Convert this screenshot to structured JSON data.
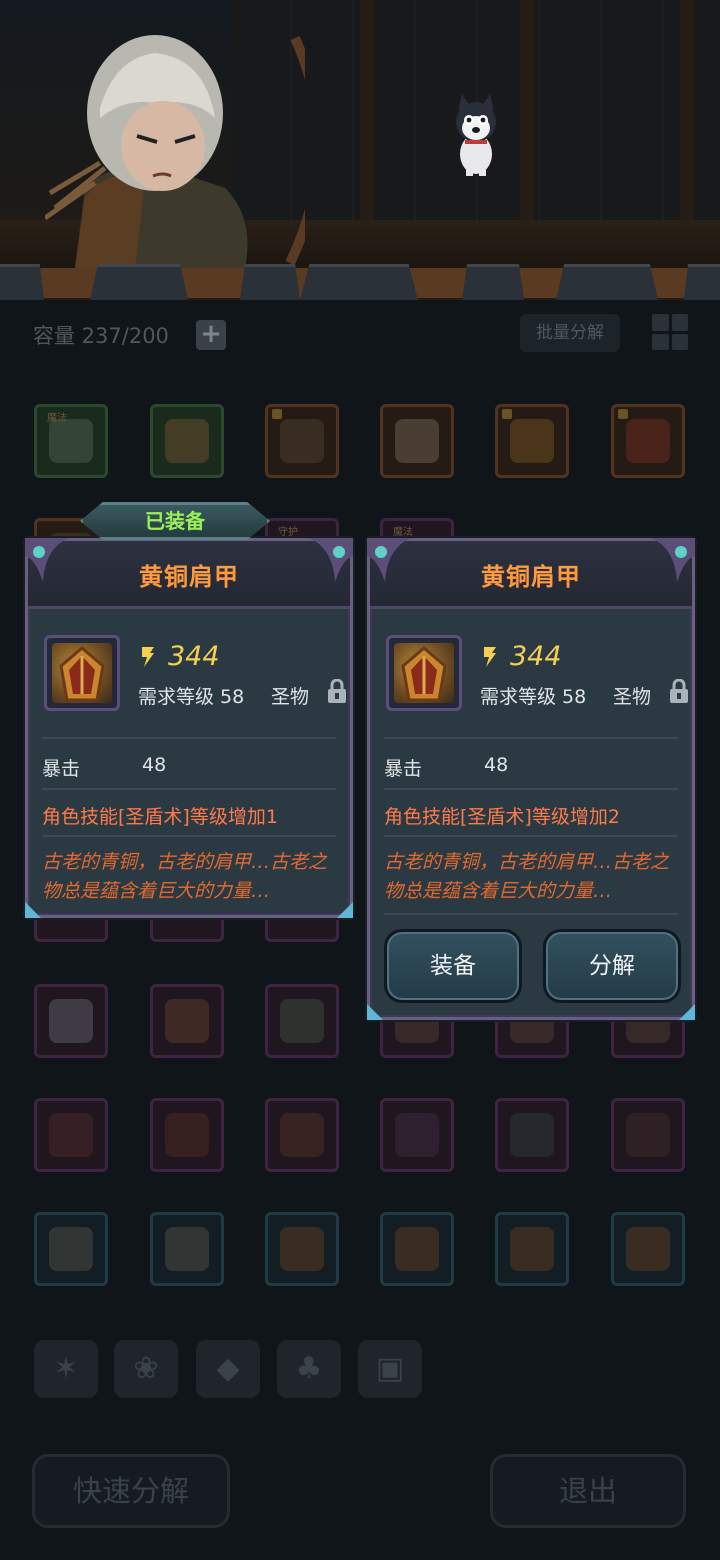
{
  "inventory": {
    "capacity_label": "容量 237/200",
    "batch_button": "批量分解",
    "slot_tags": [
      "魔法",
      "守护",
      "魔法"
    ]
  },
  "category_tabs": [
    "weapon-tab-icon",
    "pet-tab-icon",
    "gem-tab-icon",
    "material-tab-icon",
    "chest-tab-icon"
  ],
  "bottom": {
    "quick_decompose": "快速分解",
    "exit": "退出"
  },
  "equipped_label": "已装备",
  "equipped_card": {
    "title": "黄铜肩甲",
    "power": "344",
    "req_level": "需求等级 58",
    "rarity": "圣物",
    "stat_name": "暴击",
    "stat_value": "48",
    "skill": "角色技能[圣盾术]等级增加1",
    "lore": "古老的青铜，古老的肩甲…古老之物总是蕴含着巨大的力量…"
  },
  "compare_card": {
    "title": "黄铜肩甲",
    "power": "344",
    "req_level": "需求等级 58",
    "rarity": "圣物",
    "stat_name": "暴击",
    "stat_value": "48",
    "skill": "角色技能[圣盾术]等级增加2",
    "lore": "古老的青铜，古老的肩甲…古老之物总是蕴含着巨大的力量…",
    "equip_button": "装备",
    "decompose_button": "分解"
  },
  "colors": {
    "title_orange": "#ff9a3d",
    "power_gold": "#f7d052",
    "skill_orange": "#ff7a4a",
    "equipped_green": "#9bf05a"
  }
}
